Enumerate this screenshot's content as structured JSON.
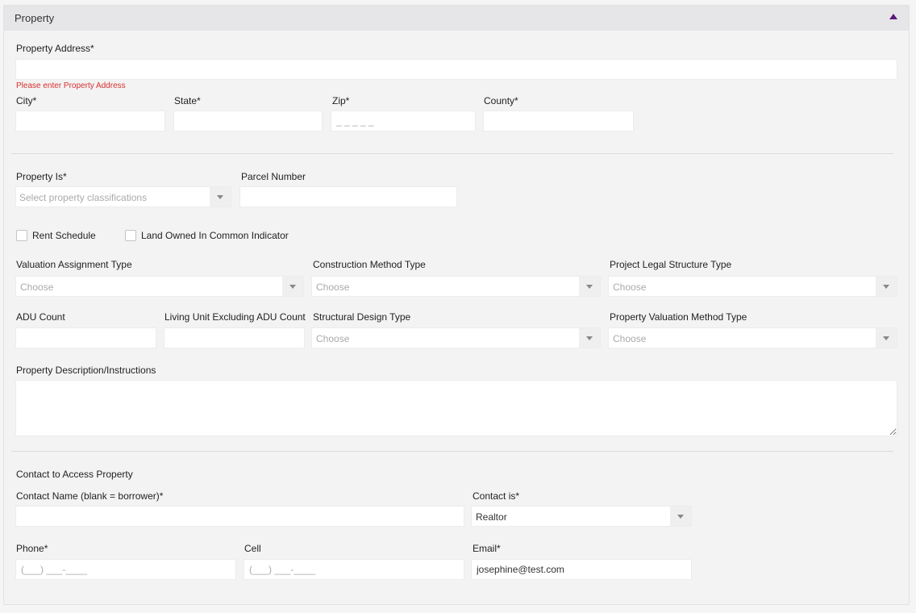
{
  "header": {
    "title": "Property"
  },
  "address": {
    "label": "Property Address*",
    "error": "Please enter Property Address",
    "city_label": "City*",
    "state_label": "State*",
    "zip_label": "Zip*",
    "zip_placeholder": "_ _ _ _ _",
    "county_label": "County*"
  },
  "classification": {
    "property_is_label": "Property Is*",
    "property_is_placeholder": "Select property classifications",
    "parcel_label": "Parcel Number"
  },
  "checkboxes": {
    "rent_schedule": "Rent Schedule",
    "land_owned": "Land Owned In Common Indicator"
  },
  "valuation": {
    "assignment_label": "Valuation Assignment Type",
    "construction_label": "Construction Method Type",
    "legal_label": "Project Legal Structure Type",
    "choose": "Choose",
    "adu_label": "ADU Count",
    "living_label": "Living Unit Excluding ADU Count",
    "structural_label": "Structural Design Type",
    "method_label": "Property Valuation Method Type"
  },
  "description": {
    "label": "Property Description/Instructions"
  },
  "contact": {
    "section_title": "Contact to Access Property",
    "name_label": "Contact Name (blank = borrower)*",
    "is_label": "Contact is*",
    "is_value": "Realtor",
    "phone_label": "Phone*",
    "phone_placeholder": "(___) ___-____",
    "cell_label": "Cell",
    "cell_placeholder": "(___) ___-____",
    "email_label": "Email*",
    "email_value": "josephine@test.com"
  },
  "colors": {
    "accent": "#5c1a7a",
    "error": "#d8302f",
    "header_bg": "#e6e6e9"
  }
}
